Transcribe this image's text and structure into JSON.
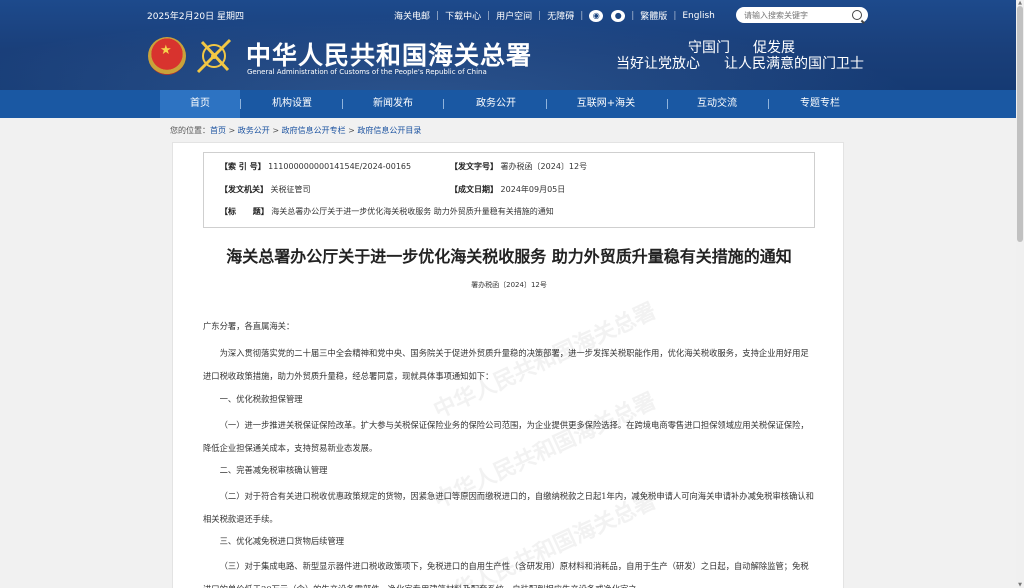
{
  "topbar": {
    "date": "2025年2月20日 星期四",
    "links": [
      "海关电邮",
      "下载中心",
      "用户空间",
      "无障碍"
    ],
    "social_icons": [
      "weibo-icon",
      "wechat-icon"
    ],
    "lang_links": [
      "繁體版",
      "English"
    ],
    "search_placeholder": "请输入搜索关键字"
  },
  "brand": {
    "title_cn": "中华人民共和国海关总署",
    "title_en": "General Administration of Customs of the People's Republic of China",
    "slogan_1a": "守国门",
    "slogan_1b": "促发展",
    "slogan_2a": "当好让党放心",
    "slogan_2b": "让人民满意的国门卫士"
  },
  "nav": [
    "首页",
    "机构设置",
    "新闻发布",
    "政务公开",
    "互联网+海关",
    "互动交流",
    "专题专栏"
  ],
  "breadcrumb": {
    "prefix": "您的位置：",
    "items": [
      "首页",
      "政务公开",
      "政府信息公开专栏",
      "政府信息公开目录"
    ]
  },
  "meta": {
    "index_label": "【索 引 号】",
    "index_value": "11100000000014154E/2024-00165",
    "docno_label": "【发文字号】",
    "docno_value": "署办税函〔2024〕12号",
    "org_label": "【发文机关】",
    "org_value": "关税征管司",
    "date_label": "【成文日期】",
    "date_value": "2024年09月05日",
    "title_label": "【标      题】",
    "title_value": "海关总署办公厅关于进一步优化海关税收服务 助力外贸质升量稳有关措施的通知"
  },
  "document": {
    "title": "海关总署办公厅关于进一步优化海关税收服务 助力外贸质升量稳有关措施的通知",
    "number": "署办税函〔2024〕12号",
    "salutation": "广东分署，各直属海关：",
    "intro": "为深入贯彻落实党的二十届三中全会精神和党中央、国务院关于促进外贸质升量稳的决策部署，进一步发挥关税职能作用，优化海关税收服务，支持企业用好用足进口税收政策措施，助力外贸质升量稳，经总署同意，现就具体事项通知如下：",
    "h1": "一、优化税款担保管理",
    "p1": "（一）进一步推进关税保证保险改革。扩大参与关税保证保险业务的保险公司范围，为企业提供更多保险选择。在跨境电商零售进口担保领域应用关税保证保险，降低企业担保通关成本，支持贸易新业态发展。",
    "h2": "二、完善减免税审核确认管理",
    "p2": "（二）对于符合有关进口税收优惠政策规定的货物，因紧急进口等原因而缴税进口的，自缴纳税款之日起1年内，减免税申请人可向海关申请补办减免税审核确认和相关税款退还手续。",
    "h3": "三、优化减免税进口货物后续管理",
    "p3": "（三）对于集成电路、新型显示器件进口税收政策项下，免税进口的自用生产性（含研发用）原材料和消耗品，自用于生产（研发）之日起，自动解除监管；免税进口的单价低于20万元（含）的生产设备零部件、净化室专用建筑材料及配套系统，自装配到相应生产设备或净化室之"
  },
  "watermark": "中华人民共和国海关总署"
}
